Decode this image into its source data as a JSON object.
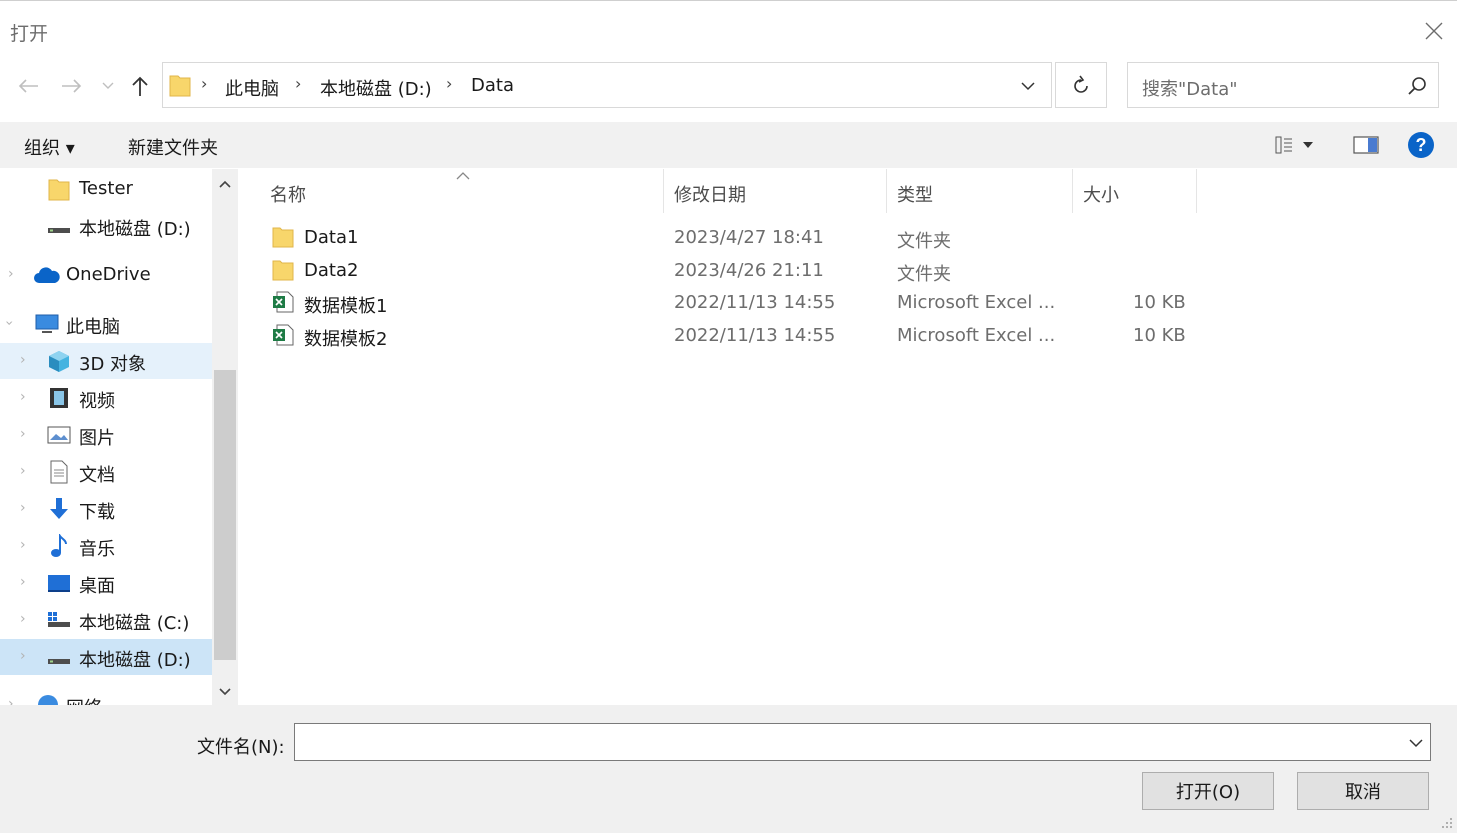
{
  "window": {
    "title": "打开"
  },
  "nav": {
    "breadcrumb": [
      "此电脑",
      "本地磁盘 (D:)",
      "Data"
    ],
    "search_placeholder": "搜索\"Data\""
  },
  "toolbar": {
    "organize": "组织 ▾",
    "new_folder": "新建文件夹"
  },
  "sidebar": {
    "items": [
      {
        "label": "Tester",
        "icon": "folder-icon"
      },
      {
        "label": "本地磁盘 (D:)",
        "icon": "drive-icon"
      },
      {
        "label": "OneDrive",
        "icon": "cloud-icon"
      },
      {
        "label": "此电脑",
        "icon": "computer-icon"
      },
      {
        "label": "3D 对象",
        "icon": "cube-icon"
      },
      {
        "label": "视频",
        "icon": "video-icon"
      },
      {
        "label": "图片",
        "icon": "image-icon"
      },
      {
        "label": "文档",
        "icon": "document-icon"
      },
      {
        "label": "下载",
        "icon": "download-icon"
      },
      {
        "label": "音乐",
        "icon": "music-icon"
      },
      {
        "label": "桌面",
        "icon": "desktop-icon"
      },
      {
        "label": "本地磁盘 (C:)",
        "icon": "drive-c-icon"
      },
      {
        "label": "本地磁盘 (D:)",
        "icon": "drive-icon"
      },
      {
        "label": "网络",
        "icon": "network-icon"
      }
    ]
  },
  "filelist": {
    "columns": {
      "name": "名称",
      "date": "修改日期",
      "type": "类型",
      "size": "大小"
    },
    "rows": [
      {
        "name": "Data1",
        "date": "2023/4/27 18:41",
        "type": "文件夹",
        "size": "",
        "icon": "folder-icon"
      },
      {
        "name": "Data2",
        "date": "2023/4/26 21:11",
        "type": "文件夹",
        "size": "",
        "icon": "folder-icon"
      },
      {
        "name": "数据模板1",
        "date": "2022/11/13 14:55",
        "type": "Microsoft Excel ...",
        "size": "10 KB",
        "icon": "excel-file-icon"
      },
      {
        "name": "数据模板2",
        "date": "2022/11/13 14:55",
        "type": "Microsoft Excel ...",
        "size": "10 KB",
        "icon": "excel-file-icon"
      }
    ]
  },
  "footer": {
    "filename_label": "文件名(N):",
    "filename_value": "",
    "open_label": "打开(O)",
    "cancel_label": "取消"
  },
  "colors": {
    "folder": "#f8d66b",
    "accent": "#0078d7",
    "selected_bg": "#e5f1fb",
    "help_blue": "#0a64c8"
  }
}
